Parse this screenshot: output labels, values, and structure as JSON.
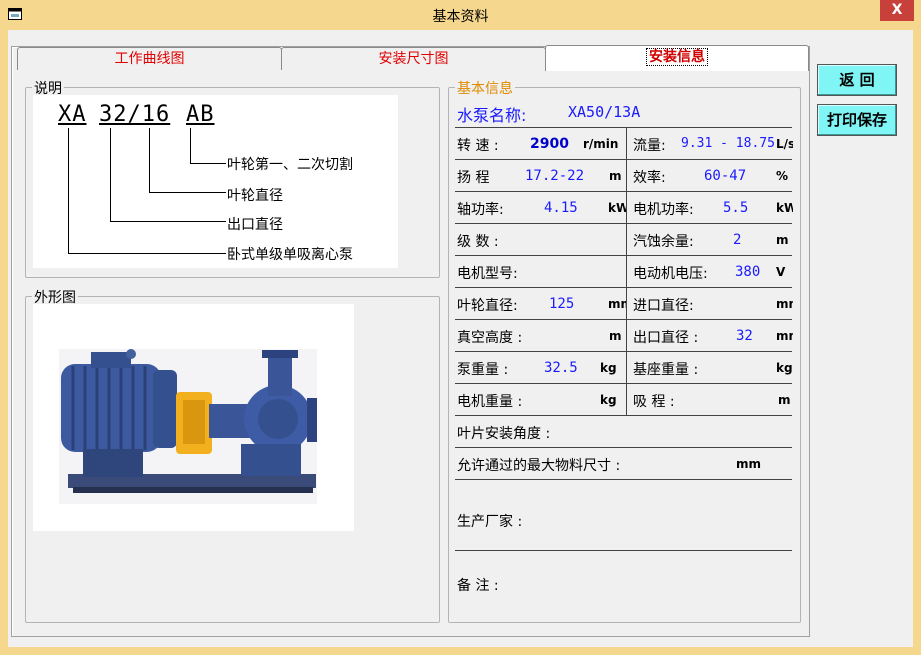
{
  "window": {
    "title": "基本资料",
    "close_label": "X"
  },
  "tabs": [
    {
      "label": "工作曲线图",
      "active": false
    },
    {
      "label": "安装尺寸图",
      "active": false
    },
    {
      "label": "安装信息",
      "active": true
    }
  ],
  "buttons": {
    "back": "返  回",
    "print_save": "打印保存"
  },
  "explain": {
    "title": "说明",
    "code_parts": [
      "XA",
      "32/16",
      "AB"
    ],
    "legend": [
      "叶轮第一、二次切割",
      "叶轮直径",
      "出口直径",
      "卧式单级单吸离心泵"
    ]
  },
  "appearance": {
    "title": "外形图"
  },
  "info": {
    "title": "基本信息",
    "pump_name_label": "水泵名称:",
    "pump_name_value": "XA50/13A",
    "rows": [
      {
        "l_label": "转  速  :",
        "l_value": "2900",
        "l_unit": "r/min",
        "r_label": "流量:",
        "r_value": "9.31 - 18.75",
        "r_unit": "L/s"
      },
      {
        "l_label": "扬  程",
        "l_value": "17.2-22",
        "l_unit": "m",
        "r_label": "效率:",
        "r_value": "60-47",
        "r_unit": "%"
      },
      {
        "l_label": "轴功率:",
        "l_value": "4.15",
        "l_unit": "kW",
        "r_label": "电机功率:",
        "r_value": "5.5",
        "r_unit": "kW"
      },
      {
        "l_label": "级  数  :",
        "l_value": "",
        "l_unit": "",
        "r_label": "汽蚀余量:",
        "r_value": "2",
        "r_unit": "m"
      },
      {
        "l_label": "电机型号:",
        "l_value": "",
        "l_unit": "",
        "r_label": "电动机电压:",
        "r_value": "380",
        "r_unit": "V"
      },
      {
        "l_label": "叶轮直径:",
        "l_value": "125",
        "l_unit": "mm",
        "r_label": "进口直径:",
        "r_value": "",
        "r_unit": "mm"
      },
      {
        "l_label": "真空高度  :",
        "l_value": "",
        "l_unit": "m",
        "r_label": "出口直径  :",
        "r_value": "32",
        "r_unit": "mm"
      },
      {
        "l_label": "泵重量  :",
        "l_value": "32.5",
        "l_unit": "kg",
        "r_label": "基座重量  :",
        "r_value": "",
        "r_unit": "kg"
      },
      {
        "l_label": "电机重量  :",
        "l_value": "",
        "l_unit": "kg",
        "r_label": "吸  程  :",
        "r_value": "",
        "r_unit": "m"
      }
    ],
    "blade_angle_label": "叶片安装角度  :",
    "max_particle_label": "允许通过的最大物料尺寸  :",
    "max_particle_unit": "mm",
    "manufacturer_label": "生产厂家  :",
    "note_label": "备    注  :"
  },
  "colors": {
    "title_bar": "#f5d88d",
    "button": "#7ff5f5",
    "value_blue": "#1a1aff",
    "tab_red": "#e00000",
    "info_title": "#e08a00"
  }
}
